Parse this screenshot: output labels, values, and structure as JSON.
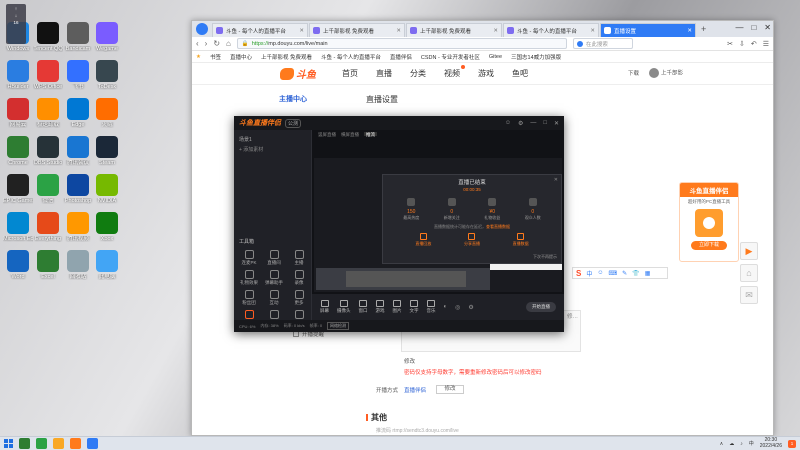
{
  "desktop": {
    "widget": {
      "lines": [
        "↑",
        "↓",
        "16"
      ]
    },
    "icons": [
      {
        "label": "Windows",
        "color": "#1e88e5"
      },
      {
        "label": "Tencent QQ",
        "color": "#111111"
      },
      {
        "label": "Bandicam",
        "color": "#5d5d5d"
      },
      {
        "label": "Wegame",
        "color": "#7a5cff"
      },
      {
        "label": "HBuilder",
        "color": "#2a7de1"
      },
      {
        "label": "WPS Office",
        "color": "#e53935"
      },
      {
        "label": "飞书",
        "color": "#3370ff"
      },
      {
        "label": "ToDesk",
        "color": "#37474f"
      },
      {
        "label": "网易云",
        "color": "#d32f2f"
      },
      {
        "label": "极速卸载",
        "color": "#ff8f00"
      },
      {
        "label": "Edge",
        "color": "#0078d4"
      },
      {
        "label": "火绒",
        "color": "#ff6d00"
      },
      {
        "label": "Chrome",
        "color": "#2e7d32"
      },
      {
        "label": "OBS Studio",
        "color": "#263238"
      },
      {
        "label": "腾讯会议",
        "color": "#1976d2"
      },
      {
        "label": "Steam",
        "color": "#1b2838"
      },
      {
        "label": "EPIC Games",
        "color": "#212121"
      },
      {
        "label": "微信",
        "color": "#2ba245"
      },
      {
        "label": "Photoshop",
        "color": "#0d47a1"
      },
      {
        "label": "NVIDIA",
        "color": "#76b900"
      },
      {
        "label": "Microsoft Edge",
        "color": "#0288d1"
      },
      {
        "label": "Everything",
        "color": "#e64a19"
      },
      {
        "label": "腾讯视频",
        "color": "#ff9800"
      },
      {
        "label": "Xbox",
        "color": "#107c10"
      },
      {
        "label": "Word",
        "color": "#1565c0"
      },
      {
        "label": "Excel",
        "color": "#2e7d32"
      },
      {
        "label": "回收站",
        "color": "#90a4ae"
      },
      {
        "label": "此电脑",
        "color": "#42a5f5"
      }
    ]
  },
  "browser": {
    "tabs": [
      {
        "label": "斗鱼 - 每个人的直播平台",
        "active": false
      },
      {
        "label": "上千部影视 免费观看",
        "active": false
      },
      {
        "label": "上千部影视 免费观看",
        "active": false
      },
      {
        "label": "斗鱼 - 每个人的直播平台",
        "active": false
      },
      {
        "label": "直播设置",
        "active": true
      }
    ],
    "new_tab": "+",
    "window_controls": [
      "—",
      "□",
      "✕"
    ],
    "nav": [
      "‹",
      "›",
      "↻",
      "⌂"
    ],
    "url_secure": "https://",
    "url_rest": "mp.douyu.com/live/main",
    "search_placeholder": "在此搜索",
    "toolbar_icons": [
      "✂",
      "⇩",
      "↶",
      "☰"
    ],
    "bookmarks": [
      "书签",
      "直播中心",
      "上千部影视 免费观看",
      "斗鱼 - 每个人的直播平台",
      "直播伴侣",
      "CSDN - 专业开发者社区",
      "Gitee",
      "三国志14威力加强版"
    ]
  },
  "site": {
    "logo_text": "斗鱼",
    "nav": [
      {
        "label": "首页",
        "active": false,
        "dot": false
      },
      {
        "label": "直播",
        "active": false,
        "dot": false
      },
      {
        "label": "分类",
        "active": false,
        "dot": false
      },
      {
        "label": "视频",
        "active": false,
        "dot": true
      },
      {
        "label": "游戏",
        "active": false,
        "dot": false
      },
      {
        "label": "鱼吧",
        "active": false,
        "dot": false
      }
    ],
    "header_right": {
      "download": "下载",
      "user": "上千部影"
    },
    "menu_title": "主播中心",
    "content_title": "直播设置",
    "verify_label": "修改",
    "warning": "密码仅支持字母数字，需要重新修改密码后可以修改密码",
    "row_label": "开播方式",
    "row_link": "直播伴侣",
    "row_button": "修改",
    "other_title": "其他",
    "other_sub": "推流码 rtmp://sendtc3.douyu.com/live",
    "checkbox_label": "开播提醒",
    "cursor_text": "修…",
    "promo": {
      "title": "斗鱼直播伴侣",
      "sub": "超好用的PC直播工具",
      "button": "立即下载"
    },
    "side_buttons": [
      {
        "icon": "▶",
        "name": "play"
      },
      {
        "icon": "⌂",
        "name": "home"
      },
      {
        "icon": "✉",
        "name": "message"
      }
    ],
    "ime": {
      "logo": "S",
      "icons": [
        "中",
        "☺",
        "⌨",
        "✎",
        "👕",
        "▦"
      ]
    }
  },
  "app": {
    "title": "斗鱼直播伴侣",
    "version": "公测",
    "controls": [
      "☺",
      "⚙",
      "—",
      "□",
      "✕"
    ],
    "scene_title": "场景1",
    "scene_items": [
      "+ 添加素材"
    ],
    "tools_title": "工具箱",
    "tools": [
      {
        "label": "连麦PK",
        "hot": false
      },
      {
        "label": "直播间",
        "hot": false
      },
      {
        "label": "主播",
        "hot": false
      },
      {
        "label": "礼物效果",
        "hot": false
      },
      {
        "label": "弹幕助手",
        "hot": false
      },
      {
        "label": "录像",
        "hot": false
      },
      {
        "label": "粉丝团",
        "hot": false
      },
      {
        "label": "互动",
        "hot": false
      },
      {
        "label": "更多",
        "hot": false
      },
      {
        "label": "直播间",
        "hot": true
      },
      {
        "label": "分享",
        "hot": false
      },
      {
        "label": "设置",
        "hot": false
      }
    ],
    "center_tabs": [
      {
        "label": "竖屏直播",
        "on": false
      },
      {
        "label": "横屏直播",
        "on": false
      },
      {
        "label": "推流",
        "on": true
      }
    ],
    "dialog": {
      "title": "直播已结束",
      "subtitle": "00:00:35",
      "close": "✕",
      "stats": [
        {
          "value": "150",
          "label": "最高热度"
        },
        {
          "value": "0",
          "label": "新增关注"
        },
        {
          "value": "¥0",
          "label": "礼物收益"
        },
        {
          "value": "0",
          "label": "观众人数"
        }
      ],
      "note_prefix": "直播数据统计可能存在延迟，",
      "note_link": "查看直播数据",
      "actions": [
        "直播回放",
        "分享直播",
        "直播数据"
      ],
      "checkbox": "下次不再提示"
    },
    "bottom_buttons": [
      "屏幕",
      "摄像头",
      "窗口",
      "游戏",
      "图片",
      "文字",
      "音乐"
    ],
    "bottom_icons": [
      "◐",
      "◎",
      "⚙"
    ],
    "start_button": "开始直播",
    "status_items": [
      "CPU: 6%",
      "内存: 38%",
      "码率: 0 kb/s",
      "帧率: 0"
    ],
    "status_button": "网络检测"
  },
  "taskbar": {
    "apps": [
      {
        "name": "chrome",
        "color": "#2e7d32"
      },
      {
        "name": "wechat",
        "color": "#2ba245"
      },
      {
        "name": "files",
        "color": "#f9a825"
      },
      {
        "name": "douyu",
        "color": "#ff7a1c"
      },
      {
        "name": "browser",
        "color": "#2f7bf5"
      }
    ],
    "tray_icons": [
      "∧",
      "☁",
      "♪",
      "中"
    ],
    "time": "20:30",
    "date": "2022/4/26",
    "notify": "1"
  }
}
